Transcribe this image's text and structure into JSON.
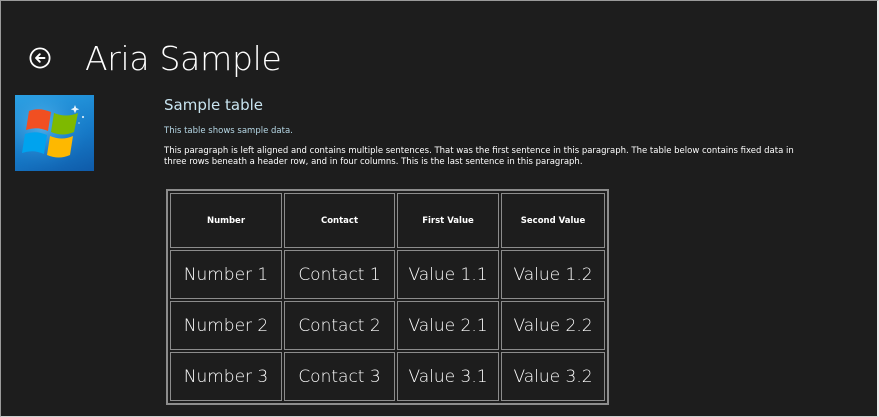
{
  "header": {
    "title": "Aria Sample",
    "back_icon": "back-arrow-circle-icon"
  },
  "logo": {
    "icon": "windows-logo-icon",
    "colors": [
      "#2aa3e6",
      "#f14f21",
      "#7eb900",
      "#00a3ee",
      "#feb800"
    ]
  },
  "main": {
    "heading": "Sample table",
    "caption": "This table shows sample data.",
    "paragraph": "This paragraph is left aligned and contains multiple sentences. That was the first sentence in this paragraph. The table below contains fixed data in three rows beneath a header row, and in four columns. This is the last sentence in this paragraph."
  },
  "table": {
    "headers": [
      "Number",
      "Contact",
      "First Value",
      "Second Value"
    ],
    "rows": [
      [
        "Number 1",
        "Contact 1",
        "Value 1.1",
        "Value 1.2"
      ],
      [
        "Number 2",
        "Contact 2",
        "Value 2.1",
        "Value 2.2"
      ],
      [
        "Number 3",
        "Contact 3",
        "Value 3.1",
        "Value 3.2"
      ]
    ]
  },
  "colors": {
    "background": "#1d1d1d",
    "heading": "#c8e4f0",
    "caption": "#b7d8e6",
    "table_border": "#8c8c8c"
  }
}
